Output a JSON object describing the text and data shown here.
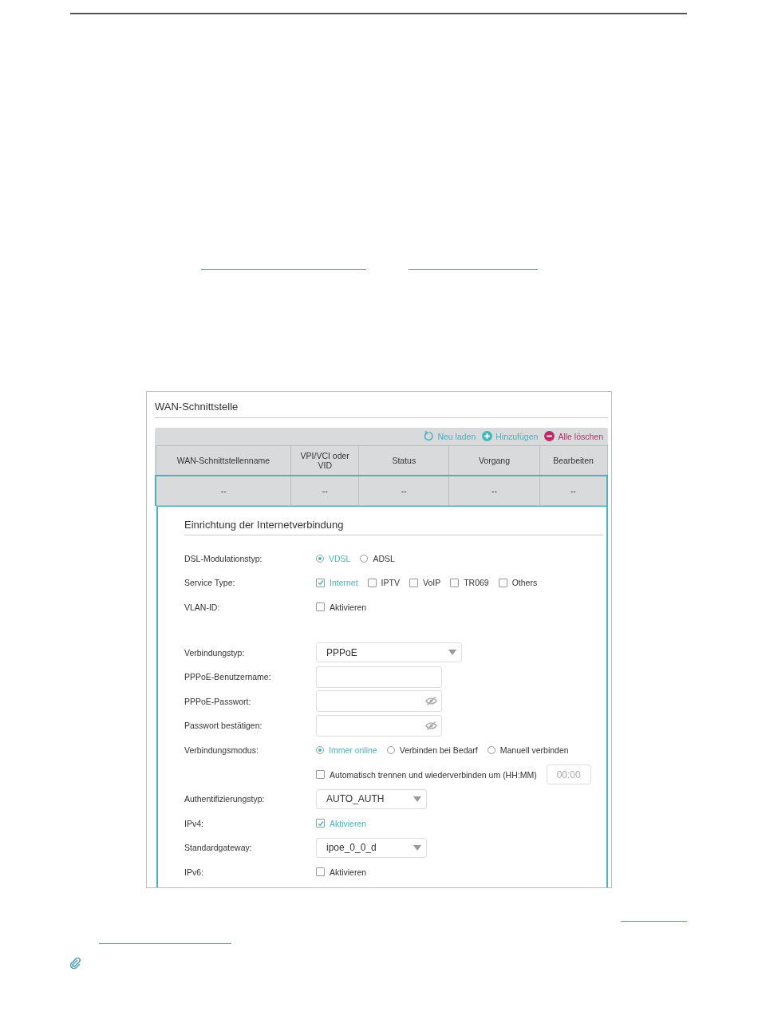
{
  "panel": {
    "title": "WAN-Schnittstelle"
  },
  "toolbar": [
    {
      "label": "Neu laden",
      "kind": "reload"
    },
    {
      "label": "Hinzufügen",
      "kind": "add"
    },
    {
      "label": "Alle löschen",
      "kind": "delete"
    }
  ],
  "table": {
    "columns": [
      "WAN-Schnittstellenname",
      "VPI/VCI oder VID",
      "Status",
      "Vorgang",
      "Bearbeiten"
    ],
    "rows": [
      [
        "--",
        "--",
        "--",
        "--",
        "--"
      ]
    ]
  },
  "section": {
    "title": "Einrichtung der Internetverbindung"
  },
  "fields": [
    {
      "kind": "radio",
      "label": "DSL-Modulationstyp:",
      "options": [
        {
          "label": "VDSL",
          "selected": true
        },
        {
          "label": "ADSL",
          "selected": false
        }
      ]
    },
    {
      "kind": "checkboxes",
      "label": "Service Type:",
      "options": [
        {
          "label": "Internet",
          "checked": true
        },
        {
          "label": "IPTV",
          "checked": false
        },
        {
          "label": "VoIP",
          "checked": false
        },
        {
          "label": "TR069",
          "checked": false
        },
        {
          "label": "Others",
          "checked": false
        }
      ]
    },
    {
      "kind": "checkboxes",
      "label": "VLAN-ID:",
      "options": [
        {
          "label": "Aktivieren",
          "checked": false
        }
      ]
    },
    {
      "kind": "select",
      "label": "Verbindungstyp:",
      "value": "PPPoE"
    },
    {
      "kind": "text",
      "label": "PPPoE-Benutzername:"
    },
    {
      "kind": "password",
      "label": "PPPoE-Passwort:"
    },
    {
      "kind": "password",
      "label": "Passwort bestätigen:"
    },
    {
      "kind": "radio",
      "label": "Verbindungsmodus:",
      "options": [
        {
          "label": "Immer online",
          "selected": true
        },
        {
          "label": "Verbinden bei Bedarf",
          "selected": false
        },
        {
          "label": "Manuell verbinden",
          "selected": false
        }
      ]
    },
    {
      "kind": "timed",
      "options": [
        {
          "label": "Automatisch trennen und wiederverbinden um (HH:MM)",
          "checked": false
        }
      ],
      "placeholder": "00:00"
    },
    {
      "kind": "select",
      "label": "Authentifizierungstyp:",
      "value": "AUTO_AUTH"
    },
    {
      "kind": "checkboxes",
      "label": "IPv4:",
      "options": [
        {
          "label": "Aktivieren",
          "checked": true
        }
      ]
    },
    {
      "kind": "select",
      "label": "Standardgateway:",
      "value": "ipoe_0_0_d"
    },
    {
      "kind": "checkboxes",
      "label": "IPv6:",
      "options": [
        {
          "label": "Aktivieren",
          "checked": false
        }
      ]
    }
  ]
}
